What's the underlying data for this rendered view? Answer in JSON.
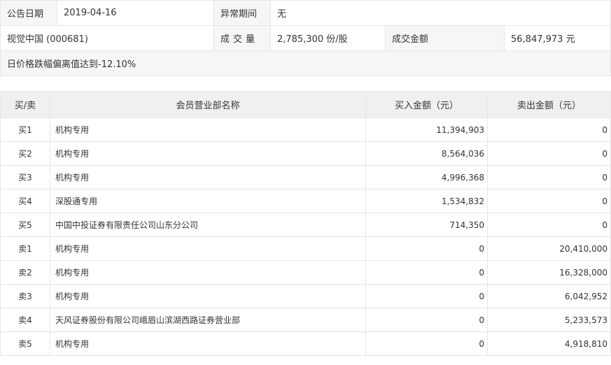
{
  "info": {
    "date_label": "公告日期",
    "date_value": "2019-04-16",
    "period_label": "异常期间",
    "period_value": "无",
    "stock": "视觉中国 (000681)",
    "volume_label": "成交量",
    "volume_value": "2,785,300 份/股",
    "amount_label": "成交金额",
    "amount_value": "56,847,973 元",
    "reason": "日价格跌幅偏离值达到-12.10%"
  },
  "table": {
    "headers": [
      "买/卖",
      "会员营业部名称",
      "买入金额（元）",
      "卖出金额（元）"
    ],
    "rows": [
      {
        "side": "买1",
        "name": "机构专用",
        "buy": "11,394,903",
        "sell": "0"
      },
      {
        "side": "买2",
        "name": "机构专用",
        "buy": "8,564,036",
        "sell": "0"
      },
      {
        "side": "买3",
        "name": "机构专用",
        "buy": "4,996,368",
        "sell": "0"
      },
      {
        "side": "买4",
        "name": "深股通专用",
        "buy": "1,534,832",
        "sell": "0"
      },
      {
        "side": "买5",
        "name": "中国中投证券有限责任公司山东分公司",
        "buy": "714,350",
        "sell": "0"
      },
      {
        "side": "卖1",
        "name": "机构专用",
        "buy": "0",
        "sell": "20,410,000"
      },
      {
        "side": "卖2",
        "name": "机构专用",
        "buy": "0",
        "sell": "16,328,000"
      },
      {
        "side": "卖3",
        "name": "机构专用",
        "buy": "0",
        "sell": "6,042,952"
      },
      {
        "side": "卖4",
        "name": "天风证券股份有限公司峨眉山滨湖西路证券营业部",
        "buy": "0",
        "sell": "5,233,573"
      },
      {
        "side": "卖5",
        "name": "机构专用",
        "buy": "0",
        "sell": "4,918,810"
      }
    ]
  }
}
